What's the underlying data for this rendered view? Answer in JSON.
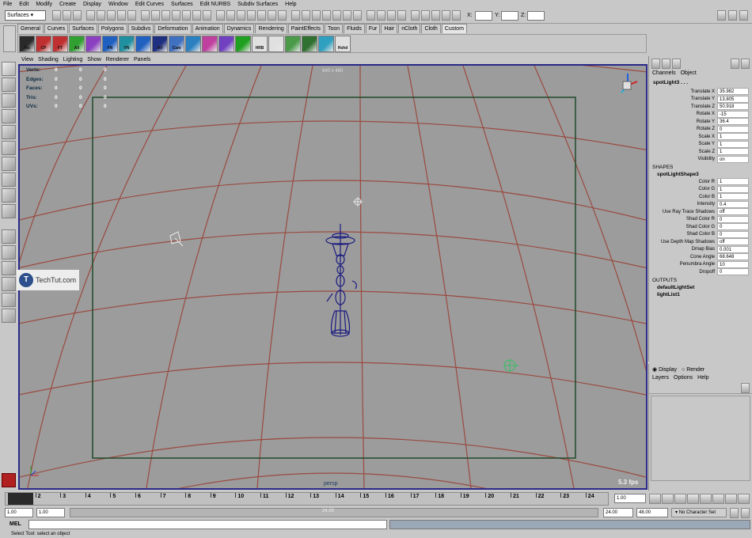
{
  "menubar": [
    "File",
    "Edit",
    "Modify",
    "Create",
    "Display",
    "Window",
    "Edit Curves",
    "Surfaces",
    "Edit NURBS",
    "Subdiv Surfaces",
    "Help"
  ],
  "status": {
    "mode": "Surfaces",
    "x_label": "X:",
    "y_label": "Y:",
    "z_label": "Z:"
  },
  "shelf_tabs": [
    "General",
    "Curves",
    "Surfaces",
    "Polygons",
    "Subdivs",
    "Deformation",
    "Animation",
    "Dynamics",
    "Rendering",
    "PaintEffects",
    "Toon",
    "Fluids",
    "Fur",
    "Hair",
    "nCloth",
    "Cloth",
    "Custom"
  ],
  "shelf_buttons": [
    {
      "label": "His",
      "color": "#2a2a2a"
    },
    {
      "label": "CP",
      "color": "#c03030"
    },
    {
      "label": "FT",
      "color": "#c03030"
    },
    {
      "label": "All",
      "color": "#30a030"
    },
    {
      "label": "",
      "color": "#8a40c0"
    },
    {
      "label": "FN",
      "color": "#2060c0"
    },
    {
      "label": "VN",
      "color": "#2090a0"
    },
    {
      "label": "",
      "color": "#2060c0"
    },
    {
      "label": "All",
      "color": "#203080"
    },
    {
      "label": "Cam",
      "color": "#4070c0"
    },
    {
      "label": "",
      "color": "#2a80c0"
    },
    {
      "label": "",
      "color": "#c040a0"
    },
    {
      "label": "",
      "color": "#7040c0"
    },
    {
      "label": "",
      "color": "#20a020"
    },
    {
      "label": "HRB",
      "color": "#e0e0e0"
    },
    {
      "label": "",
      "color": "#e0e0e0"
    },
    {
      "label": "",
      "color": "#4a9a4a"
    },
    {
      "label": "",
      "color": "#307030"
    },
    {
      "label": "",
      "color": "#30a0c0"
    },
    {
      "label": "Hshd",
      "color": "#e0e0e0"
    }
  ],
  "panel_menu": [
    "View",
    "Shading",
    "Lighting",
    "Show",
    "Renderer",
    "Panels"
  ],
  "hud": {
    "labels": [
      "Verts:",
      "Edges:",
      "Faces:",
      "Tris:",
      "UVs:"
    ],
    "resolution": "640 x 480",
    "camera": "persp",
    "fps": "5.3 fps"
  },
  "watermark": "TechTut.com",
  "channelbox": {
    "tabs": [
      "Channels",
      "Object"
    ],
    "object": "spotLight3 . . .",
    "attrs": [
      {
        "l": "Translate X",
        "v": "35.982"
      },
      {
        "l": "Translate Y",
        "v": "13.805"
      },
      {
        "l": "Translate Z",
        "v": "50.918"
      },
      {
        "l": "Rotate X",
        "v": "-15"
      },
      {
        "l": "Rotate Y",
        "v": "36.4"
      },
      {
        "l": "Rotate Z",
        "v": "0"
      },
      {
        "l": "Scale X",
        "v": "1"
      },
      {
        "l": "Scale Y",
        "v": "1"
      },
      {
        "l": "Scale Z",
        "v": "1"
      },
      {
        "l": "Visibility",
        "v": "on"
      }
    ],
    "shapes_header": "SHAPES",
    "shape_name": "spotLightShape3",
    "shape_attrs": [
      {
        "l": "Color R",
        "v": "1"
      },
      {
        "l": "Color G",
        "v": "1"
      },
      {
        "l": "Color B",
        "v": "1"
      },
      {
        "l": "Intensity",
        "v": "0.4"
      },
      {
        "l": "Use Ray Trace Shadows",
        "v": "off"
      },
      {
        "l": "Shad Color R",
        "v": "0"
      },
      {
        "l": "Shad Color G",
        "v": "0"
      },
      {
        "l": "Shad Color B",
        "v": "0"
      },
      {
        "l": "Use Depth Map Shadows",
        "v": "off"
      },
      {
        "l": "Dmap Bias",
        "v": "0.001"
      },
      {
        "l": "Cone Angle",
        "v": "68.648"
      },
      {
        "l": "Penumbra Angle",
        "v": "10"
      },
      {
        "l": "Dropoff",
        "v": "0"
      }
    ],
    "outputs_header": "OUTPUTS",
    "outputs": [
      "defaultLightSet",
      "lightList1"
    ]
  },
  "layers": {
    "display": "Display",
    "render": "Render",
    "menu": [
      "Layers",
      "Options",
      "Help"
    ]
  },
  "timeline": {
    "ticks": [
      "1",
      "2",
      "3",
      "4",
      "5",
      "6",
      "7",
      "8",
      "9",
      "10",
      "11",
      "12",
      "13",
      "14",
      "15",
      "16",
      "17",
      "18",
      "19",
      "20",
      "21",
      "22",
      "23",
      "24"
    ],
    "current": "1.00"
  },
  "range": {
    "start": "1.00",
    "start2": "1.00",
    "mid": "24.00",
    "end": "24.00",
    "end2": "48.00",
    "charset": "No Character Set"
  },
  "cmd": {
    "label": "MEL"
  },
  "help": "Select Tool: select an object"
}
